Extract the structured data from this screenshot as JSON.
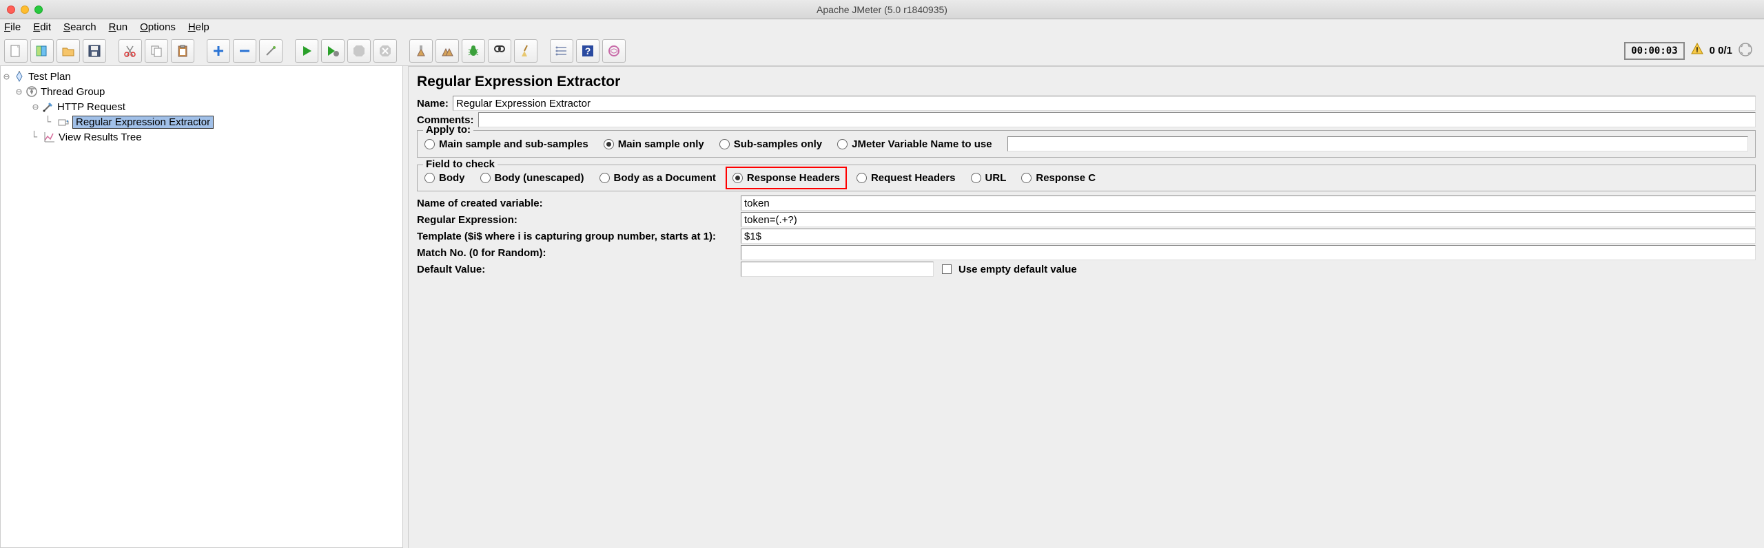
{
  "window_title": "Apache JMeter (5.0 r1840935)",
  "menu": {
    "file": "File",
    "edit": "Edit",
    "search": "Search",
    "run": "Run",
    "options": "Options",
    "help": "Help"
  },
  "status": {
    "timer": "00:00:03",
    "threads": "0  0/1"
  },
  "tree": {
    "testplan": "Test Plan",
    "threadgroup": "Thread Group",
    "httprequest": "HTTP Request",
    "regex": "Regular Expression Extractor",
    "viewresults": "View Results Tree"
  },
  "panel": {
    "title": "Regular Expression Extractor",
    "name_label": "Name:",
    "name_value": "Regular Expression Extractor",
    "comments_label": "Comments:",
    "comments_value": "",
    "apply_legend": "Apply to:",
    "apply_options": {
      "main_sub": "Main sample and sub-samples",
      "main_only": "Main sample only",
      "sub_only": "Sub-samples only",
      "jvar": "JMeter Variable Name to use"
    },
    "field_legend": "Field to check",
    "field_options": {
      "body": "Body",
      "body_unesc": "Body (unescaped)",
      "body_doc": "Body as a Document",
      "resp_headers": "Response Headers",
      "req_headers": "Request Headers",
      "url": "URL",
      "resp_c": "Response C"
    },
    "var_label": "Name of created variable:",
    "var_value": "token",
    "regex_label": "Regular Expression:",
    "regex_value": "token=(.+?)",
    "template_label": "Template ($i$ where i is capturing group number, starts at 1):",
    "template_value": "$1$",
    "match_label": "Match No. (0 for Random):",
    "match_value": "",
    "default_label": "Default Value:",
    "default_value": "",
    "empty_checkbox": "Use empty default value"
  }
}
